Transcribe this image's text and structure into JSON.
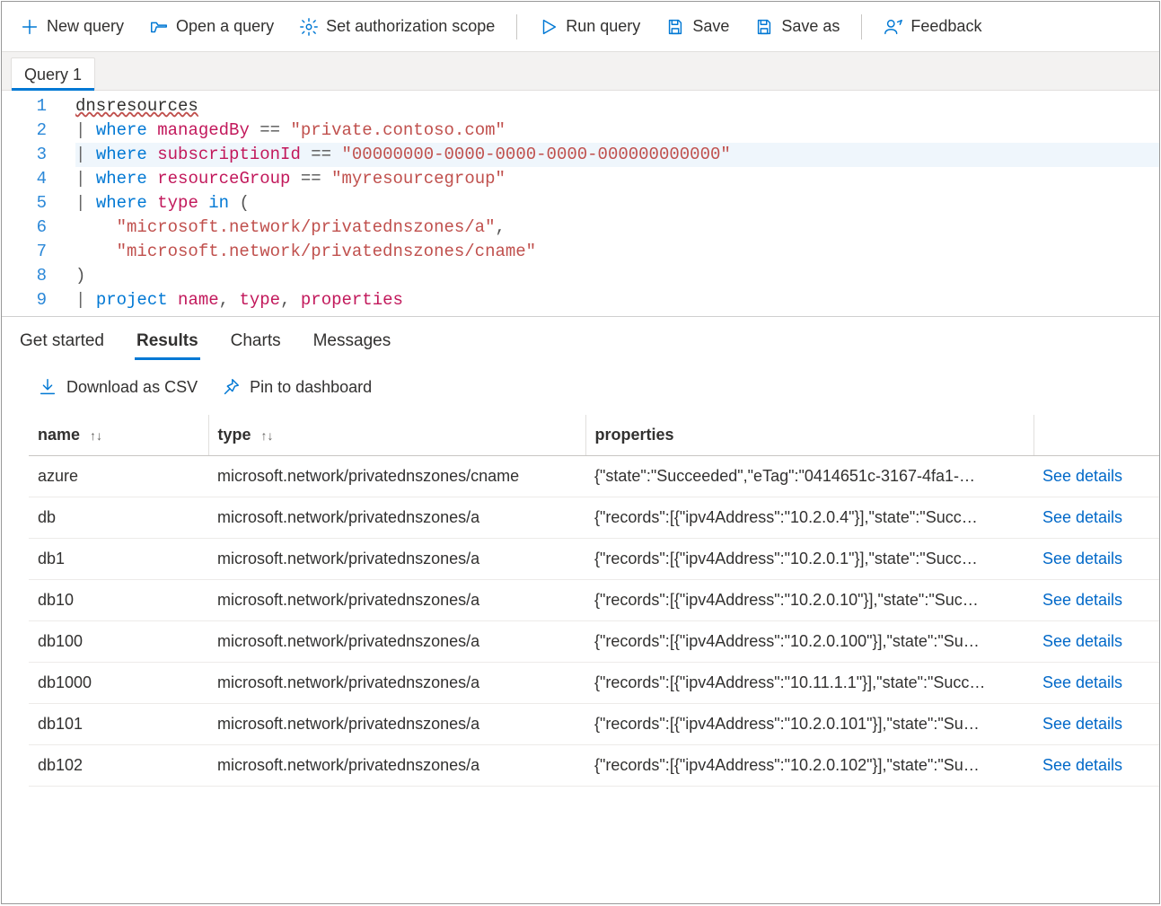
{
  "toolbar": {
    "new_query": "New query",
    "open_query": "Open a query",
    "set_scope": "Set authorization scope",
    "run_query": "Run query",
    "save": "Save",
    "save_as": "Save as",
    "feedback": "Feedback"
  },
  "tabs": {
    "query1": "Query 1"
  },
  "editor": {
    "lines": [
      {
        "n": 1,
        "tokens": [
          [
            "squiggle",
            "dnsresources"
          ]
        ]
      },
      {
        "n": 2,
        "tokens": [
          [
            "pipe",
            "| "
          ],
          [
            "kw",
            "where"
          ],
          [
            "plain",
            " "
          ],
          [
            "col",
            "managedBy"
          ],
          [
            "plain",
            " "
          ],
          [
            "op",
            "=="
          ],
          [
            "plain",
            " "
          ],
          [
            "str",
            "\"private.contoso.com\""
          ]
        ]
      },
      {
        "n": 3,
        "hl": true,
        "tokens": [
          [
            "pipe",
            "| "
          ],
          [
            "kw",
            "where"
          ],
          [
            "plain",
            " "
          ],
          [
            "col",
            "subscriptionId"
          ],
          [
            "plain",
            " "
          ],
          [
            "op",
            "=="
          ],
          [
            "plain",
            " "
          ],
          [
            "str",
            "\"00000000-0000-0000-0000-000000000000\""
          ]
        ]
      },
      {
        "n": 4,
        "tokens": [
          [
            "pipe",
            "| "
          ],
          [
            "kw",
            "where"
          ],
          [
            "plain",
            " "
          ],
          [
            "col",
            "resourceGroup"
          ],
          [
            "plain",
            " "
          ],
          [
            "op",
            "=="
          ],
          [
            "plain",
            " "
          ],
          [
            "str",
            "\"myresourcegroup\""
          ]
        ]
      },
      {
        "n": 5,
        "tokens": [
          [
            "pipe",
            "| "
          ],
          [
            "kw",
            "where"
          ],
          [
            "plain",
            " "
          ],
          [
            "col",
            "type"
          ],
          [
            "plain",
            " "
          ],
          [
            "kw",
            "in"
          ],
          [
            "plain",
            " "
          ],
          [
            "punct",
            "("
          ]
        ]
      },
      {
        "n": 6,
        "tokens": [
          [
            "plain",
            "    "
          ],
          [
            "str",
            "\"microsoft.network/privatednszones/a\""
          ],
          [
            "punct",
            ","
          ]
        ]
      },
      {
        "n": 7,
        "tokens": [
          [
            "plain",
            "    "
          ],
          [
            "str",
            "\"microsoft.network/privatednszones/cname\""
          ]
        ]
      },
      {
        "n": 8,
        "tokens": [
          [
            "punct",
            ")"
          ]
        ]
      },
      {
        "n": 9,
        "tokens": [
          [
            "pipe",
            "| "
          ],
          [
            "kw",
            "project"
          ],
          [
            "plain",
            " "
          ],
          [
            "col",
            "name"
          ],
          [
            "punct",
            ","
          ],
          [
            "plain",
            " "
          ],
          [
            "col",
            "type"
          ],
          [
            "punct",
            ","
          ],
          [
            "plain",
            " "
          ],
          [
            "col",
            "properties"
          ]
        ]
      }
    ]
  },
  "result_tabs": {
    "get_started": "Get started",
    "results": "Results",
    "charts": "Charts",
    "messages": "Messages"
  },
  "result_actions": {
    "download_csv": "Download as CSV",
    "pin_dashboard": "Pin to dashboard"
  },
  "table": {
    "headers": {
      "name": "name",
      "type": "type",
      "properties": "properties"
    },
    "sort_glyph": "↑↓",
    "details_label": "See details",
    "rows": [
      {
        "name": "azure",
        "type": "microsoft.network/privatednszones/cname",
        "properties": "{\"state\":\"Succeeded\",\"eTag\":\"0414651c-3167-4fa1-…"
      },
      {
        "name": "db",
        "type": "microsoft.network/privatednszones/a",
        "properties": "{\"records\":[{\"ipv4Address\":\"10.2.0.4\"}],\"state\":\"Succ…"
      },
      {
        "name": "db1",
        "type": "microsoft.network/privatednszones/a",
        "properties": "{\"records\":[{\"ipv4Address\":\"10.2.0.1\"}],\"state\":\"Succ…"
      },
      {
        "name": "db10",
        "type": "microsoft.network/privatednszones/a",
        "properties": "{\"records\":[{\"ipv4Address\":\"10.2.0.10\"}],\"state\":\"Suc…"
      },
      {
        "name": "db100",
        "type": "microsoft.network/privatednszones/a",
        "properties": "{\"records\":[{\"ipv4Address\":\"10.2.0.100\"}],\"state\":\"Su…"
      },
      {
        "name": "db1000",
        "type": "microsoft.network/privatednszones/a",
        "properties": "{\"records\":[{\"ipv4Address\":\"10.11.1.1\"}],\"state\":\"Succ…"
      },
      {
        "name": "db101",
        "type": "microsoft.network/privatednszones/a",
        "properties": "{\"records\":[{\"ipv4Address\":\"10.2.0.101\"}],\"state\":\"Su…"
      },
      {
        "name": "db102",
        "type": "microsoft.network/privatednszones/a",
        "properties": "{\"records\":[{\"ipv4Address\":\"10.2.0.102\"}],\"state\":\"Su…"
      }
    ]
  }
}
